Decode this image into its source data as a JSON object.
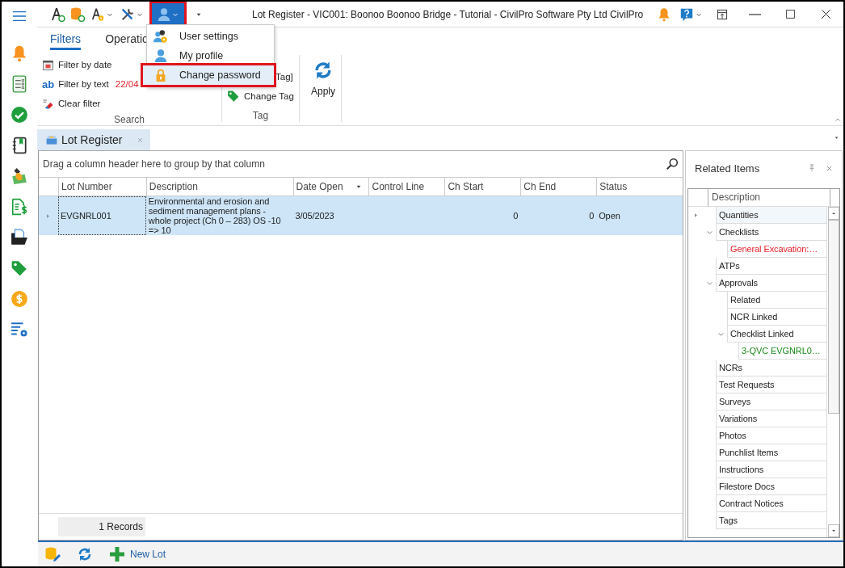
{
  "window": {
    "title": "Lot Register - VIC001: Boonoo Boonoo Bridge - Tutorial - CivilPro Software Pty Ltd CivilPro"
  },
  "quick_access": {
    "user_button": {
      "selected": true,
      "outlined": true
    }
  },
  "user_menu": {
    "items": [
      {
        "kind": "settings",
        "label": "User settings",
        "highlighted": false,
        "outlined": false
      },
      {
        "kind": "profile",
        "label": "My profile",
        "highlighted": false,
        "outlined": false
      },
      {
        "kind": "password",
        "label": "Change password",
        "highlighted": true,
        "outlined": true
      }
    ]
  },
  "ribbon": {
    "tabs": [
      {
        "label": "Filters",
        "selected": true
      },
      {
        "label": "Operatio",
        "selected": false
      }
    ],
    "groups": [
      {
        "label": "Search",
        "items": [
          {
            "kind": "date",
            "label": "Filter by date"
          },
          {
            "kind": "text",
            "icon_text": "ab",
            "label": "Filter by text",
            "value": "22/04"
          },
          {
            "kind": "clear",
            "label": "Clear filter"
          }
        ]
      },
      {
        "label": "Tag",
        "items": [
          {
            "kind": "plain",
            "label": "Tag]"
          },
          {
            "kind": "tag",
            "label": "Change Tag"
          }
        ]
      },
      {
        "items": [
          {
            "kind": "apply",
            "label": "Apply"
          }
        ]
      }
    ]
  },
  "document_tabs": [
    {
      "label": "Lot Register",
      "selected": true
    }
  ],
  "grid": {
    "group_panel": "Drag a column header here to group by that column",
    "columns": [
      {
        "label": "Lot Number",
        "sorted": false
      },
      {
        "label": "Description",
        "sorted": false
      },
      {
        "label": "Date Open",
        "sorted": true
      },
      {
        "label": "Control Line",
        "sorted": false
      },
      {
        "label": "Ch Start",
        "sorted": false
      },
      {
        "label": "Ch End",
        "sorted": false
      },
      {
        "label": "Status",
        "sorted": false
      }
    ],
    "rows": [
      {
        "selected": true,
        "lot_number": "EVGNRL001",
        "description": "Environmental and erosion and sediment management plans - whole project (Ch 0 – 283) OS -10 => 10",
        "date_open": "3/05/2023",
        "ch_start": "0",
        "ch_end": "0",
        "status": "Open"
      }
    ],
    "footer": {
      "records": "1 Records"
    }
  },
  "related_items": {
    "title": "Related Items",
    "column": "Description",
    "rows": [
      {
        "label": "Quantities",
        "selected": true
      },
      {
        "label": "Checklists",
        "selected": false,
        "expanded": true,
        "children": [
          {
            "label": "General Excavation:…",
            "selected": false,
            "color": "#e8202a"
          }
        ]
      },
      {
        "label": "ATPs",
        "selected": false
      },
      {
        "label": "Approvals",
        "selected": false,
        "expanded": true,
        "children": [
          {
            "label": "Related",
            "selected": false
          },
          {
            "label": "NCR Linked",
            "selected": false
          },
          {
            "label": "Checklist Linked",
            "selected": false,
            "expanded": true,
            "children": [
              {
                "label": "3-QVC EVGNRL0…",
                "selected": false,
                "color": "#1a8a1a"
              }
            ]
          }
        ]
      },
      {
        "label": "NCRs",
        "selected": false
      },
      {
        "label": "Test Requests",
        "selected": false
      },
      {
        "label": "Surveys",
        "selected": false
      },
      {
        "label": "Variations",
        "selected": false
      },
      {
        "label": "Photos",
        "selected": false
      },
      {
        "label": "Punchlist Items",
        "selected": false
      },
      {
        "label": "Instructions",
        "selected": false
      },
      {
        "label": "Filestore Docs",
        "selected": false
      },
      {
        "label": "Contract Notices",
        "selected": false
      },
      {
        "label": "Tags",
        "selected": false
      }
    ]
  },
  "bottom_bar": {
    "buttons": [
      {
        "kind": "database-edit"
      },
      {
        "kind": "refresh"
      },
      {
        "kind": "add",
        "label": "New Lot"
      }
    ]
  }
}
